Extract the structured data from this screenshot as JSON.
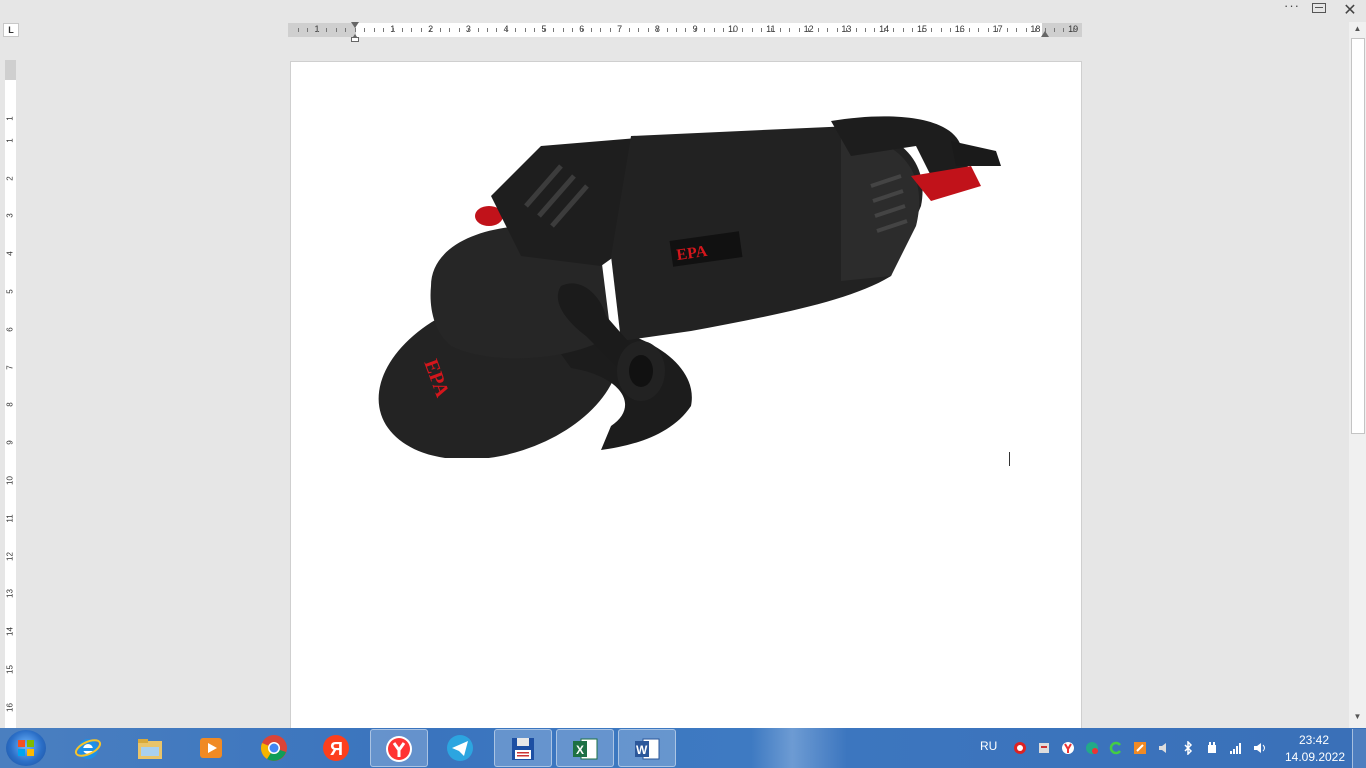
{
  "window": {
    "more_label": "···",
    "close_label": "✕"
  },
  "ruler": {
    "tab_selector": "L",
    "horizontal_labels": [
      "1",
      "1",
      "2",
      "3",
      "4",
      "5",
      "6",
      "7",
      "8",
      "9",
      "10",
      "11",
      "12",
      "13",
      "14",
      "15",
      "16",
      "17",
      "18",
      "19"
    ],
    "vertical_labels": [
      "1",
      "1",
      "2",
      "3",
      "4",
      "5",
      "6",
      "7",
      "8",
      "9",
      "10",
      "11",
      "12",
      "13",
      "14",
      "15",
      "16",
      "17"
    ]
  },
  "document": {
    "image_logo_text": "EPA"
  },
  "taskbar": {
    "apps": [
      {
        "name": "internet-explorer",
        "active": false
      },
      {
        "name": "file-explorer",
        "active": false
      },
      {
        "name": "media-player",
        "active": false
      },
      {
        "name": "chrome",
        "active": false
      },
      {
        "name": "yandex",
        "active": false
      },
      {
        "name": "yandex-browser",
        "active": true
      },
      {
        "name": "telegram",
        "active": false
      },
      {
        "name": "save-app",
        "active": true
      },
      {
        "name": "excel",
        "active": true
      },
      {
        "name": "word",
        "active": true
      }
    ],
    "yandex_label": "Я",
    "excel_label": "X",
    "word_label": "W",
    "language": "RU",
    "time": "23:42",
    "date": "14.09.2022"
  },
  "colors": {
    "accent_red": "#d4161c",
    "taskbar_blue": "#3a74be"
  }
}
